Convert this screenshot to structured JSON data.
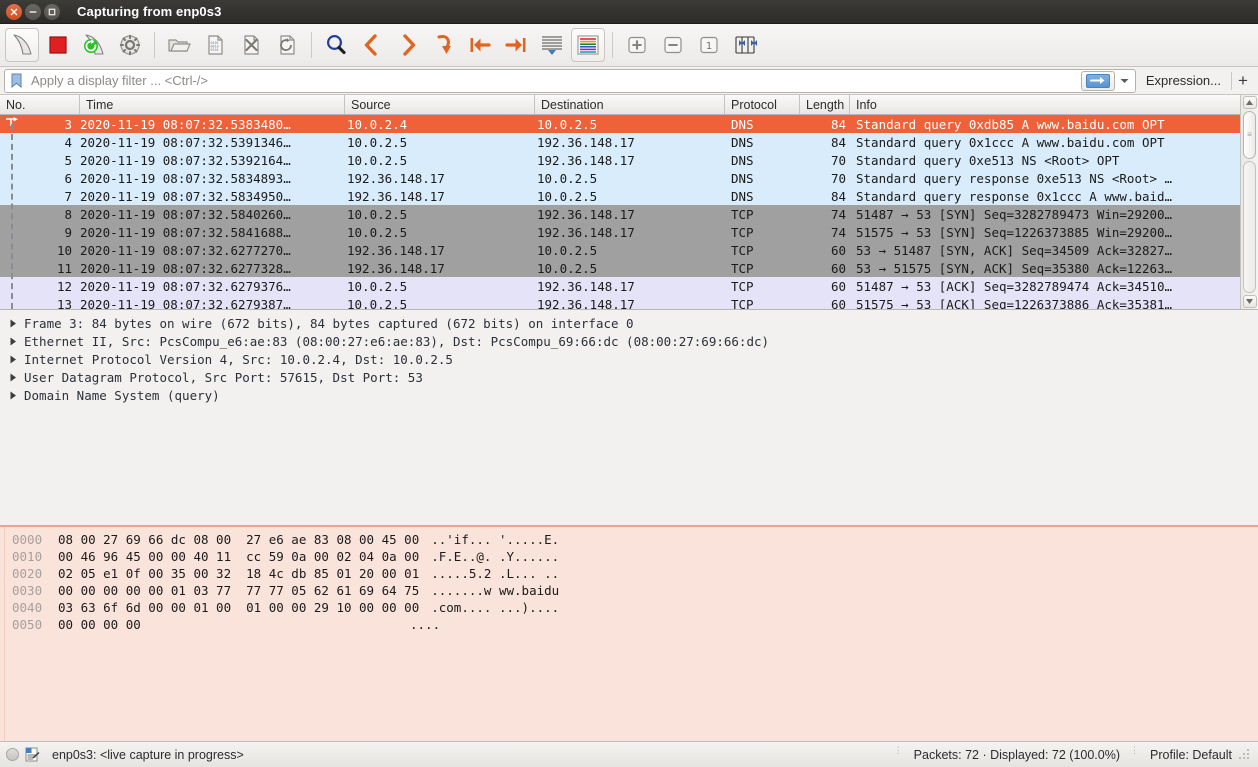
{
  "window": {
    "title": "Capturing from enp0s3",
    "buttons": {
      "close": "close-icon",
      "minimize": "minimize-icon",
      "maximize": "maximize-icon"
    }
  },
  "toolbar": {
    "items": [
      {
        "name": "start-capture-button",
        "icon": "shark-fin-icon"
      },
      {
        "name": "stop-capture-button",
        "icon": "stop-square-icon"
      },
      {
        "name": "restart-capture-button",
        "icon": "restart-capture-icon"
      },
      {
        "name": "capture-options-button",
        "icon": "gear-icon"
      },
      {
        "name": "open-file-button",
        "icon": "folder-open-icon"
      },
      {
        "name": "save-file-button",
        "icon": "save-file-icon"
      },
      {
        "name": "close-file-button",
        "icon": "close-file-icon"
      },
      {
        "name": "reload-file-button",
        "icon": "reload-icon"
      },
      {
        "name": "find-packet-button",
        "icon": "magnifier-icon"
      },
      {
        "name": "go-back-button",
        "icon": "chevron-left-icon"
      },
      {
        "name": "go-forward-button",
        "icon": "chevron-right-icon"
      },
      {
        "name": "go-to-packet-button",
        "icon": "goto-arrow-icon"
      },
      {
        "name": "go-to-first-button",
        "icon": "arrow-to-start-icon"
      },
      {
        "name": "go-to-last-button",
        "icon": "arrow-to-end-icon"
      },
      {
        "name": "autoscroll-button",
        "icon": "autoscroll-icon"
      },
      {
        "name": "colorize-button",
        "icon": "colorize-packets-icon"
      },
      {
        "name": "zoom-in-button",
        "icon": "zoom-in-icon"
      },
      {
        "name": "zoom-out-button",
        "icon": "zoom-out-icon"
      },
      {
        "name": "zoom-reset-button",
        "icon": "zoom-reset-icon"
      },
      {
        "name": "resize-columns-button",
        "icon": "resize-columns-icon"
      }
    ]
  },
  "filter": {
    "placeholder": "Apply a display filter ... <Ctrl-/>",
    "value": "",
    "bookmark_icon": "bookmark-icon",
    "apply_icon": "apply-filter-arrow-icon",
    "dropdown_icon": "chevron-down-icon",
    "expression_label": "Expression...",
    "add_label": "+"
  },
  "packet_list": {
    "columns": [
      "No.",
      "Time",
      "Source",
      "Destination",
      "Protocol",
      "Length",
      "Info"
    ],
    "rows": [
      {
        "no": "3",
        "time": "2020-11-19 08:07:32.5383480…",
        "src": "10.0.2.4",
        "dst": "10.0.2.5",
        "protocol": "DNS",
        "length": "84",
        "info": "Standard query 0xdb85 A www.baidu.com OPT",
        "style": "sel"
      },
      {
        "no": "4",
        "time": "2020-11-19 08:07:32.5391346…",
        "src": "10.0.2.5",
        "dst": "192.36.148.17",
        "protocol": "DNS",
        "length": "84",
        "info": "Standard query 0x1ccc A www.baidu.com OPT",
        "style": "dns"
      },
      {
        "no": "5",
        "time": "2020-11-19 08:07:32.5392164…",
        "src": "10.0.2.5",
        "dst": "192.36.148.17",
        "protocol": "DNS",
        "length": "70",
        "info": "Standard query 0xe513 NS <Root> OPT",
        "style": "dns"
      },
      {
        "no": "6",
        "time": "2020-11-19 08:07:32.5834893…",
        "src": "192.36.148.17",
        "dst": "10.0.2.5",
        "protocol": "DNS",
        "length": "70",
        "info": "Standard query response 0xe513 NS <Root> …",
        "style": "dns"
      },
      {
        "no": "7",
        "time": "2020-11-19 08:07:32.5834950…",
        "src": "192.36.148.17",
        "dst": "10.0.2.5",
        "protocol": "DNS",
        "length": "84",
        "info": "Standard query response 0x1ccc A www.baid…",
        "style": "dns"
      },
      {
        "no": "8",
        "time": "2020-11-19 08:07:32.5840260…",
        "src": "10.0.2.5",
        "dst": "192.36.148.17",
        "protocol": "TCP",
        "length": "74",
        "info": "51487 → 53 [SYN] Seq=3282789473 Win=29200…",
        "style": "tcp"
      },
      {
        "no": "9",
        "time": "2020-11-19 08:07:32.5841688…",
        "src": "10.0.2.5",
        "dst": "192.36.148.17",
        "protocol": "TCP",
        "length": "74",
        "info": "51575 → 53 [SYN] Seq=1226373885 Win=29200…",
        "style": "tcp"
      },
      {
        "no": "10",
        "time": "2020-11-19 08:07:32.6277270…",
        "src": "192.36.148.17",
        "dst": "10.0.2.5",
        "protocol": "TCP",
        "length": "60",
        "info": "53 → 51487 [SYN, ACK] Seq=34509 Ack=32827…",
        "style": "tcp"
      },
      {
        "no": "11",
        "time": "2020-11-19 08:07:32.6277328…",
        "src": "192.36.148.17",
        "dst": "10.0.2.5",
        "protocol": "TCP",
        "length": "60",
        "info": "53 → 51575 [SYN, ACK] Seq=35380 Ack=12263…",
        "style": "tcp"
      },
      {
        "no": "12",
        "time": "2020-11-19 08:07:32.6279376…",
        "src": "10.0.2.5",
        "dst": "192.36.148.17",
        "protocol": "TCP",
        "length": "60",
        "info": "51487 → 53 [ACK] Seq=3282789474 Ack=34510…",
        "style": "ack"
      },
      {
        "no": "13",
        "time": "2020-11-19 08:07:32.6279387…",
        "src": "10.0.2.5",
        "dst": "192.36.148.17",
        "protocol": "TCP",
        "length": "60",
        "info": "51575 → 53 [ACK] Seq=1226373886 Ack=35381…",
        "style": "ack"
      }
    ],
    "colors": {
      "selected": "#ef6139",
      "dns": "#d8ecfb",
      "tcp": "#a0a0a0",
      "ack": "#e5e3f7"
    }
  },
  "packet_details": {
    "lines": [
      "Frame 3: 84 bytes on wire (672 bits), 84 bytes captured (672 bits) on interface 0",
      "Ethernet II, Src: PcsCompu_e6:ae:83 (08:00:27:e6:ae:83), Dst: PcsCompu_69:66:dc (08:00:27:69:66:dc)",
      "Internet Protocol Version 4, Src: 10.0.2.4, Dst: 10.0.2.5",
      "User Datagram Protocol, Src Port: 57615, Dst Port: 53",
      "Domain Name System (query)"
    ],
    "twisty_icon": "triangle-right-icon"
  },
  "hex_dump": {
    "lines": [
      {
        "offset": "0000",
        "bytes": "08 00 27 69 66 dc 08 00  27 e6 ae 83 08 00 45 00",
        "ascii": "..'if... '.....E."
      },
      {
        "offset": "0010",
        "bytes": "00 46 96 45 00 00 40 11  cc 59 0a 00 02 04 0a 00",
        "ascii": ".F.E..@. .Y......"
      },
      {
        "offset": "0020",
        "bytes": "02 05 e1 0f 00 35 00 32  18 4c db 85 01 20 00 01",
        "ascii": ".....5.2 .L... .."
      },
      {
        "offset": "0030",
        "bytes": "00 00 00 00 00 01 03 77  77 77 05 62 61 69 64 75",
        "ascii": ".......w ww.baidu"
      },
      {
        "offset": "0040",
        "bytes": "03 63 6f 6d 00 00 01 00  01 00 00 29 10 00 00 00",
        "ascii": ".com.... ...)...."
      },
      {
        "offset": "0050",
        "bytes": "00 00 00 00",
        "ascii": "...."
      }
    ]
  },
  "status_bar": {
    "capture_icon": "capture-status-circle-icon",
    "file_icon": "expert-info-icon",
    "interface_text": "enp0s3: <live capture in progress>",
    "packets_text": "Packets: 72 · Displayed: 72 (100.0%)",
    "profile_text": "Profile: Default"
  }
}
